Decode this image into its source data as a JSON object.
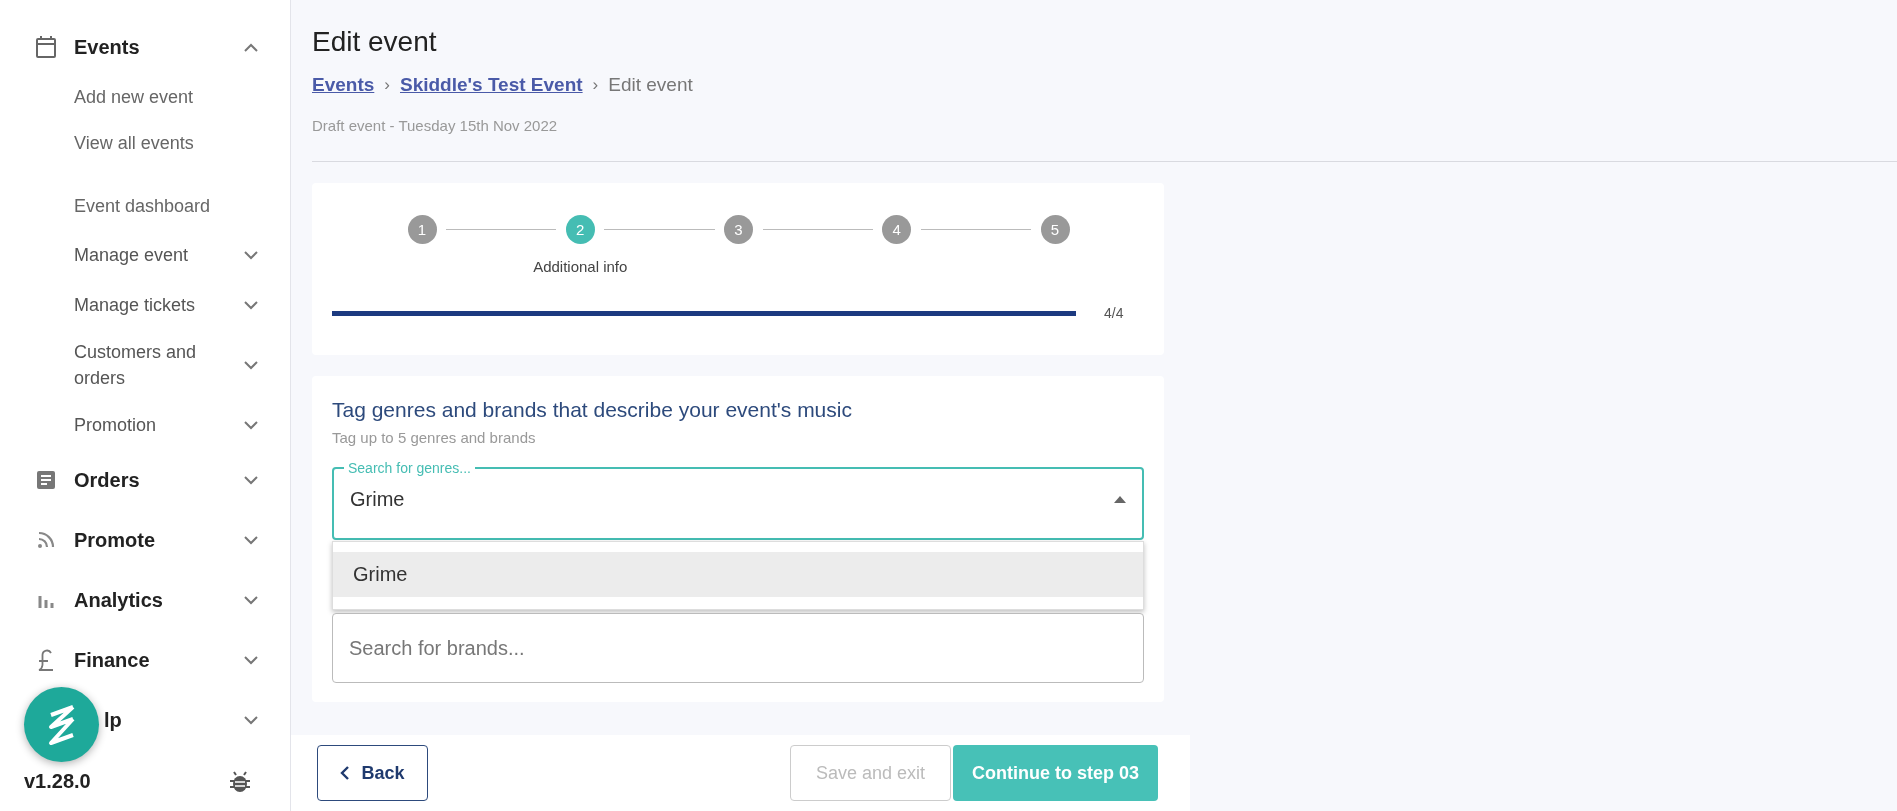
{
  "sidebar": {
    "sections": [
      {
        "label": "Events",
        "expanded": true,
        "links": [
          {
            "label": "Add new event"
          },
          {
            "label": "View all events"
          }
        ],
        "event_menu": [
          {
            "label": "Event dashboard"
          },
          {
            "label": "Manage event",
            "expanded": false
          },
          {
            "label": "Manage tickets",
            "expanded": false
          },
          {
            "label": "Customers and orders",
            "expanded": false
          },
          {
            "label": "Promotion",
            "expanded": false
          }
        ]
      },
      {
        "label": "Orders",
        "expanded": false
      },
      {
        "label": "Promote",
        "expanded": false
      },
      {
        "label": "Analytics",
        "expanded": false
      },
      {
        "label": "Finance",
        "expanded": false
      },
      {
        "label": "lp",
        "expanded": false
      }
    ],
    "version": "v1.28.0"
  },
  "page": {
    "title": "Edit event",
    "breadcrumb": [
      {
        "label": "Events",
        "kind": "link"
      },
      {
        "label": "Skiddle's Test Event",
        "kind": "link"
      },
      {
        "label": "Edit event",
        "kind": "current"
      }
    ],
    "separator": "›",
    "subtitle": "Draft event - Tuesday 15th Nov 2022"
  },
  "stepper": {
    "steps": [
      {
        "number": "1",
        "selected": false
      },
      {
        "number": "2",
        "selected": true,
        "label": "Additional info"
      },
      {
        "number": "3",
        "selected": false
      },
      {
        "number": "4",
        "selected": false
      },
      {
        "number": "5",
        "selected": false
      }
    ],
    "progress": {
      "level": 1,
      "reading": "4/4"
    }
  },
  "tags": {
    "title": "Tag genres and brands that describe your event's music",
    "hint": "Tag up to 5 genres and brands",
    "genre_field": {
      "label": "Search for genres...",
      "value": "Grime",
      "focused": true,
      "expanded": true,
      "options": [
        {
          "label": "Grime",
          "highlighted": true
        }
      ]
    },
    "brand_field": {
      "placeholder": "Search for brands..."
    }
  },
  "actions": [
    {
      "label": "Back",
      "kind": "back",
      "disabled": false
    },
    {
      "label": "Save and exit",
      "kind": "secondary",
      "disabled": true
    },
    {
      "label": "Continue to step 03",
      "kind": "primary",
      "disabled": false
    }
  ]
}
